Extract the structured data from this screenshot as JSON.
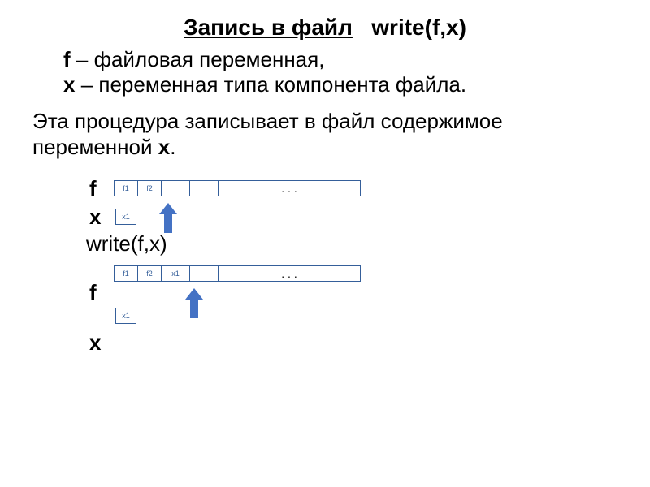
{
  "title": {
    "underlined": "Запись в файл",
    "bold": "write(f,x)"
  },
  "defs": {
    "f_var": "f",
    "f_text": " – файловая переменная,",
    "x_var": "x",
    "x_text": " – переменная типа компонента файла."
  },
  "desc": {
    "part1": "Эта процедура записывает в файл содержимое переменной ",
    "var": "x",
    "part2": "."
  },
  "labels": {
    "f": "f",
    "x": "x",
    "call": "write(f,x)"
  },
  "cells": {
    "f1": "f1",
    "f2": "f2",
    "x1": "x1",
    "dots": ". . ."
  }
}
